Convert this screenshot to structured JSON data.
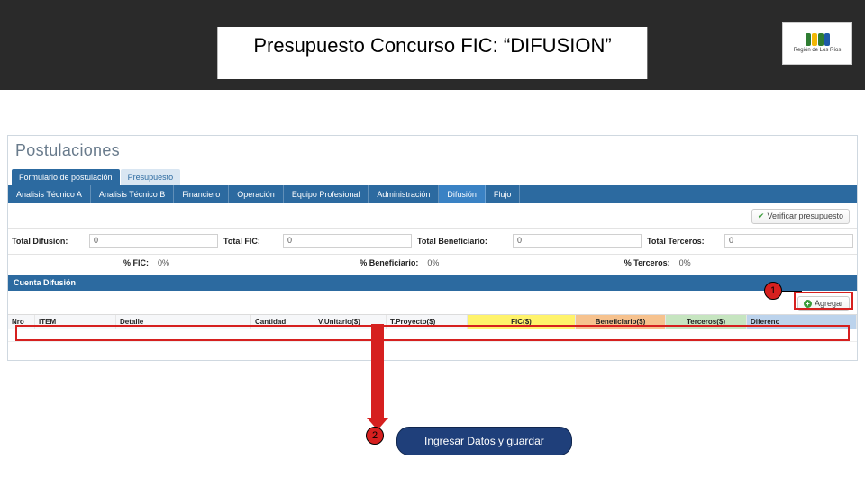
{
  "header": {
    "title": "Presupuesto Concurso FIC: “DIFUSION”",
    "logo_caption": "Región de Los Ríos"
  },
  "postulaciones_label": "Postulaciones",
  "tabs": {
    "form": "Formulario de postulación",
    "presupuesto": "Presupuesto"
  },
  "subtabs": [
    "Analisis Técnico A",
    "Analisis Técnico B",
    "Financiero",
    "Operación",
    "Equipo Profesional",
    "Administración",
    "Difusión",
    "Flujo"
  ],
  "active_subtab_index": 6,
  "verify_label": "Verificar presupuesto",
  "totals": {
    "difusion": {
      "label": "Total Difusion:",
      "value": "0"
    },
    "fic": {
      "label": "Total FIC:",
      "value": "0"
    },
    "benef": {
      "label": "Total Beneficiario:",
      "value": "0"
    },
    "terc": {
      "label": "Total Terceros:",
      "value": "0"
    }
  },
  "percents": {
    "fic": {
      "label": "% FIC:",
      "value": "0%"
    },
    "benef": {
      "label": "% Beneficiario:",
      "value": "0%"
    },
    "terc": {
      "label": "% Terceros:",
      "value": "0%"
    }
  },
  "band_title": "Cuenta Difusión",
  "add_label": "Agregar",
  "columns": {
    "nro": "Nro",
    "item": "ITEM",
    "detalle": "Detalle",
    "cantidad": "Cantidad",
    "vunit": "V.Unitario($)",
    "tproy": "T.Proyecto($)",
    "fic": "FIC($)",
    "benef": "Beneficiario($)",
    "terc": "Terceros($)",
    "dif": "Diferenc"
  },
  "callouts": {
    "one": "1",
    "two": "2"
  },
  "action_text": "Ingresar Datos y guardar"
}
